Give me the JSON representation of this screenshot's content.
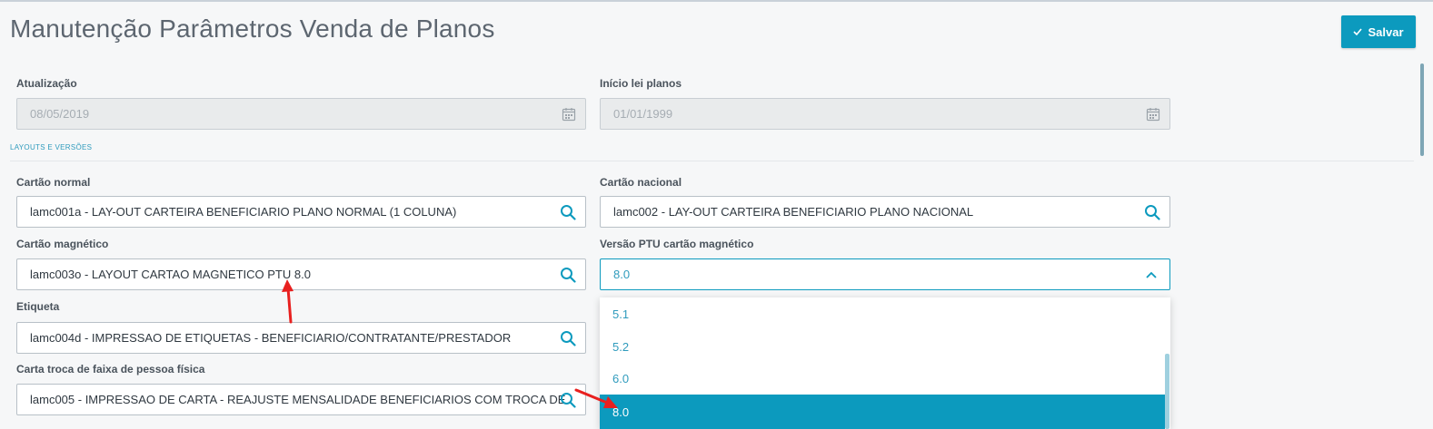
{
  "header": {
    "title": "Manutenção Parâmetros Venda de Planos",
    "save_label": "Salvar"
  },
  "dates": {
    "atualizacao_label": "Atualização",
    "atualizacao_value": "08/05/2019",
    "inicio_label": "Início lei planos",
    "inicio_value": "01/01/1999"
  },
  "section": {
    "title": "LAYOUTS E VERSÕES"
  },
  "fields": {
    "cartao_normal_label": "Cartão normal",
    "cartao_normal_value": "lamc001a - LAY-OUT CARTEIRA BENEFICIARIO PLANO NORMAL (1 COLUNA)",
    "cartao_nacional_label": "Cartão nacional",
    "cartao_nacional_value": "lamc002 - LAY-OUT CARTEIRA BENEFICIARIO PLANO NACIONAL",
    "cartao_magnetico_label": "Cartão magnético",
    "cartao_magnetico_value": "lamc003o - LAYOUT CARTAO MAGNETICO PTU 8.0",
    "versao_ptu_label": "Versão PTU cartão magnético",
    "versao_ptu_value": "8.0",
    "etiqueta_label": "Etiqueta",
    "etiqueta_value": "lamc004d - IMPRESSAO DE ETIQUETAS - BENEFICIARIO/CONTRATANTE/PRESTADOR",
    "carta_troca_label": "Carta troca de faixa de pessoa física",
    "carta_troca_value": "lamc005 - IMPRESSAO DE CARTA - REAJUSTE MENSALIDADE BENEFICIARIOS COM TROCA DE"
  },
  "dropdown": {
    "options": [
      "5.1",
      "5.2",
      "6.0",
      "8.0"
    ],
    "selected": "8.0"
  },
  "colors": {
    "accent": "#0c9abe",
    "annotation": "#e8201f"
  }
}
